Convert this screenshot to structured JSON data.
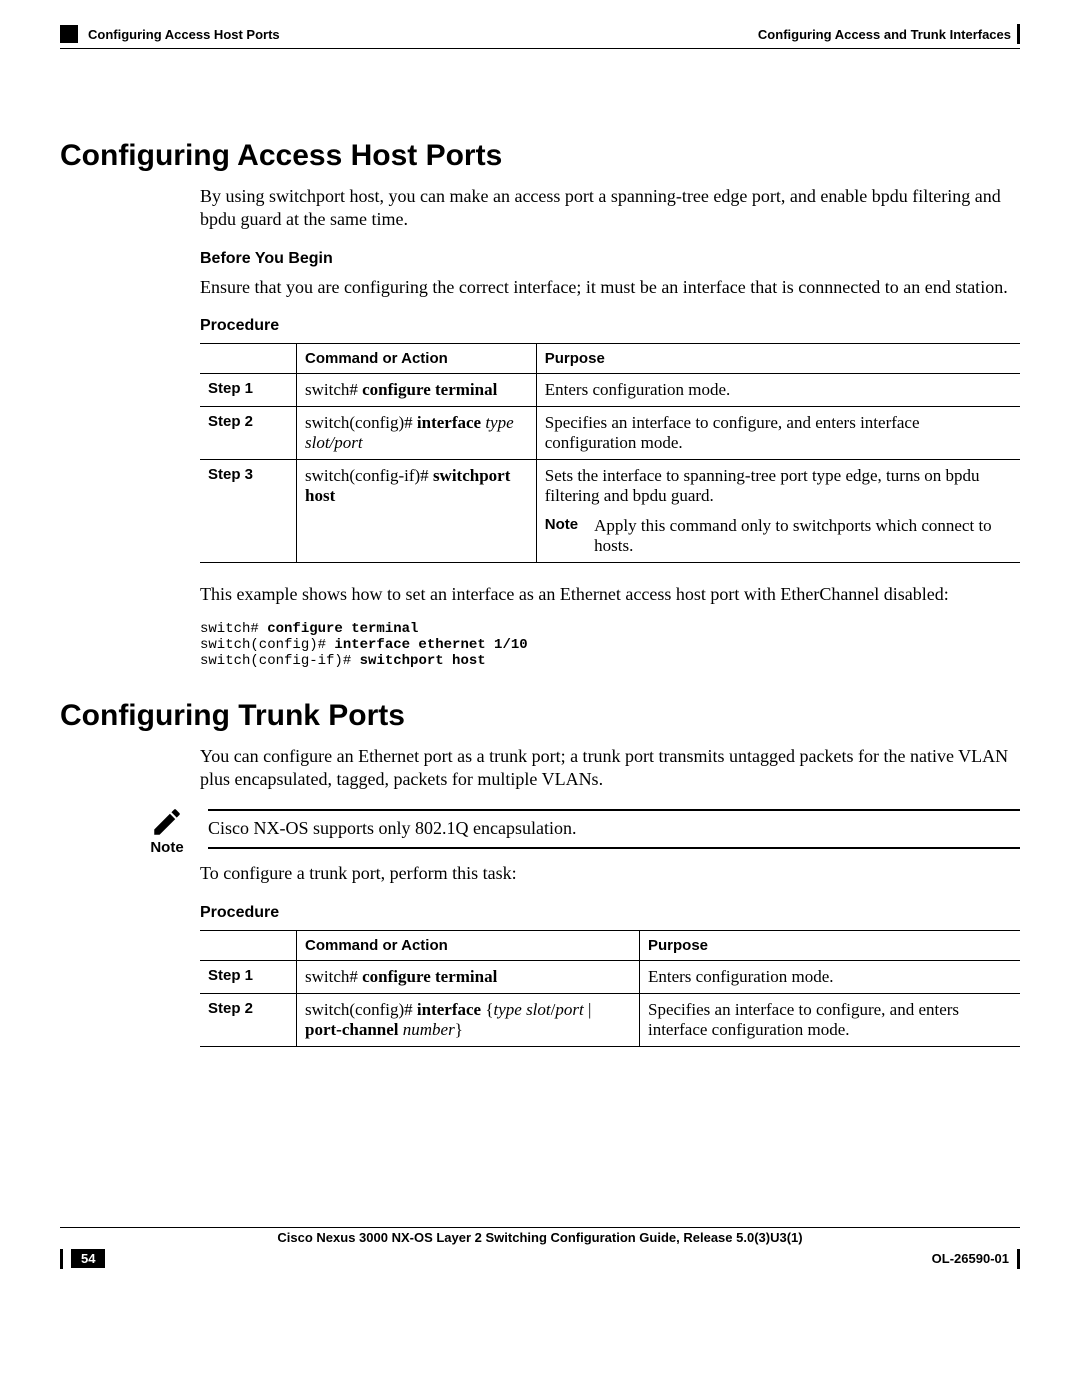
{
  "header": {
    "left_text": "Configuring Access Host Ports",
    "right_text": "Configuring Access and Trunk Interfaces"
  },
  "section1": {
    "title": "Configuring Access Host Ports",
    "intro": "By using switchport host, you can make an access port a spanning-tree edge port, and enable bpdu filtering and bpdu guard at the same time.",
    "before_heading": "Before You Begin",
    "before_text": "Ensure that you are configuring the correct interface; it must be an interface that is connnected to an end station.",
    "procedure_heading": "Procedure",
    "th_cmd": "Command or Action",
    "th_purpose": "Purpose",
    "steps": [
      {
        "label": "Step 1",
        "cmd_prefix": "switch# ",
        "cmd_bold": "configure terminal",
        "purpose": "Enters configuration mode."
      },
      {
        "label": "Step 2",
        "cmd_prefix": "switch(config)# ",
        "cmd_bold": "interface",
        "cmd_italic": " type slot/port",
        "purpose": "Specifies an interface to configure, and enters interface configuration mode."
      },
      {
        "label": "Step 3",
        "cmd_prefix": "switch(config-if)# ",
        "cmd_bold": "switchport host",
        "purpose": "Sets the interface to spanning-tree port type edge, turns on bpdu filtering and bpdu guard.",
        "note_label": "Note",
        "note_text": "Apply this command only to switchports which connect to hosts."
      }
    ],
    "example_intro": "This example shows how to set an interface as an Ethernet access host port with EtherChannel disabled:",
    "code": {
      "l1p": "switch# ",
      "l1b": "configure terminal",
      "l2p": "switch(config)# ",
      "l2b": "interface ethernet 1/10",
      "l3p": "switch(config-if)# ",
      "l3b": "switchport host"
    }
  },
  "section2": {
    "title": "Configuring Trunk Ports",
    "intro": "You can configure an Ethernet port as a trunk port; a trunk port transmits untagged packets for the native VLAN plus encapsulated, tagged, packets for multiple VLANs.",
    "note_label": "Note",
    "note_text": "Cisco NX-OS supports only 802.1Q encapsulation.",
    "task_text": "To configure a trunk port, perform this task:",
    "procedure_heading": "Procedure",
    "th_cmd": "Command or Action",
    "th_purpose": "Purpose",
    "steps": [
      {
        "label": "Step 1",
        "cmd_prefix": "switch# ",
        "cmd_bold": "configure terminal",
        "purpose": "Enters configuration mode."
      },
      {
        "label": "Step 2",
        "cmd_prefix": "switch(config)# ",
        "cmd_bold": "interface",
        "cmd_mixed": " {type slot/port | port-channel number}",
        "purpose": "Specifies an interface to configure, and enters interface configuration mode."
      }
    ]
  },
  "footer": {
    "title": "Cisco Nexus 3000 NX-OS Layer 2 Switching Configuration Guide, Release 5.0(3)U3(1)",
    "page_num": "54",
    "right_text": "OL-26590-01"
  }
}
